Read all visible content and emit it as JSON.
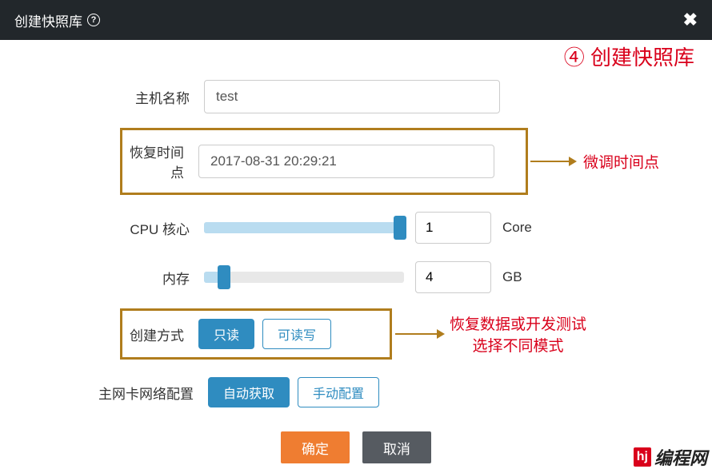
{
  "header": {
    "title": "创建快照库",
    "help_glyph": "?",
    "close_glyph": "✖"
  },
  "annotations": {
    "top": "④ 创建快照库",
    "time_tune": "微调时间点",
    "mode_note_line1": "恢复数据或开发测试",
    "mode_note_line2": "选择不同模式"
  },
  "form": {
    "host_label": "主机名称",
    "host_value": "test",
    "restore_label": "恢复时间点",
    "restore_value": "2017-08-31 20:29:21",
    "cpu_label": "CPU 核心",
    "cpu_value": "1",
    "cpu_unit": "Core",
    "cpu_fill_pct": 98,
    "mem_label": "内存",
    "mem_value": "4",
    "mem_unit": "GB",
    "mem_fill_pct": 10,
    "mode_label": "创建方式",
    "mode_opts": {
      "readonly": "只读",
      "readwrite": "可读写"
    },
    "net_label": "主网卡网络配置",
    "net_opts": {
      "auto": "自动获取",
      "manual": "手动配置"
    }
  },
  "footer": {
    "ok": "确定",
    "cancel": "取消"
  },
  "watermark": {
    "badge": "hj",
    "text": "编程网"
  }
}
